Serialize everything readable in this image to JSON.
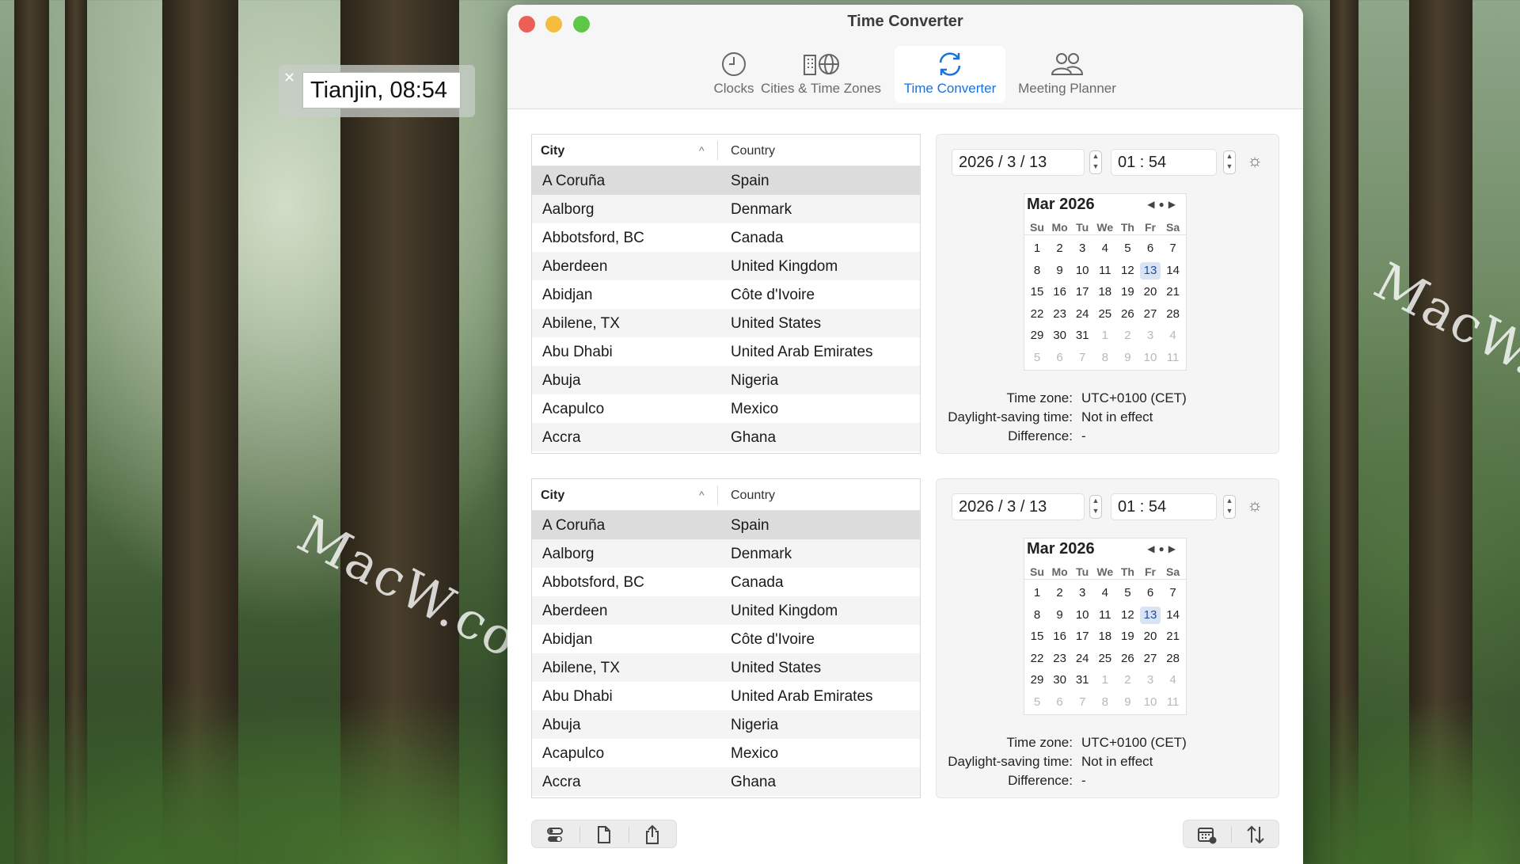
{
  "float_clock": {
    "label": "Tianjin, 08:54"
  },
  "window": {
    "title": "Time Converter"
  },
  "tabs": [
    {
      "label": "Clocks",
      "icon": "clock-icon"
    },
    {
      "label": "Cities & Time Zones",
      "icon": "globe-city-icon"
    },
    {
      "label": "Time Converter",
      "icon": "refresh-icon",
      "active": true
    },
    {
      "label": "Meeting Planner",
      "icon": "people-icon"
    }
  ],
  "table_headers": {
    "city": "City",
    "country": "Country"
  },
  "cities": [
    {
      "city": "A Coruña",
      "country": "Spain"
    },
    {
      "city": "Aalborg",
      "country": "Denmark"
    },
    {
      "city": "Abbotsford, BC",
      "country": "Canada"
    },
    {
      "city": "Aberdeen",
      "country": "United Kingdom"
    },
    {
      "city": "Abidjan",
      "country": "Côte d'Ivoire"
    },
    {
      "city": "Abilene, TX",
      "country": "United States"
    },
    {
      "city": "Abu Dhabi",
      "country": "United Arab Emirates"
    },
    {
      "city": "Abuja",
      "country": "Nigeria"
    },
    {
      "city": "Acapulco",
      "country": "Mexico"
    },
    {
      "city": "Accra",
      "country": "Ghana"
    }
  ],
  "converter": {
    "date": "2026 / 3 / 13",
    "time": "01 : 54",
    "calendar": {
      "title": "Mar 2026",
      "dow": [
        "Su",
        "Mo",
        "Tu",
        "We",
        "Th",
        "Fr",
        "Sa"
      ],
      "weeks": [
        [
          "1",
          "2",
          "3",
          "4",
          "5",
          "6",
          "7"
        ],
        [
          "8",
          "9",
          "10",
          "11",
          "12",
          "13",
          "14"
        ],
        [
          "15",
          "16",
          "17",
          "18",
          "19",
          "20",
          "21"
        ],
        [
          "22",
          "23",
          "24",
          "25",
          "26",
          "27",
          "28"
        ],
        [
          "29",
          "30",
          "31",
          "1",
          "2",
          "3",
          "4"
        ],
        [
          "5",
          "6",
          "7",
          "8",
          "9",
          "10",
          "11"
        ]
      ],
      "today": "13"
    },
    "info": [
      {
        "label": "Time zone:",
        "value": "UTC+0100 (CET)"
      },
      {
        "label": "Daylight-saving time:",
        "value": "Not in effect"
      },
      {
        "label": "Difference:",
        "value": "-"
      }
    ]
  },
  "watermark": "MacW.com",
  "colors": {
    "accent": "#1a72e0",
    "selected_row": "#dcdcdc"
  }
}
